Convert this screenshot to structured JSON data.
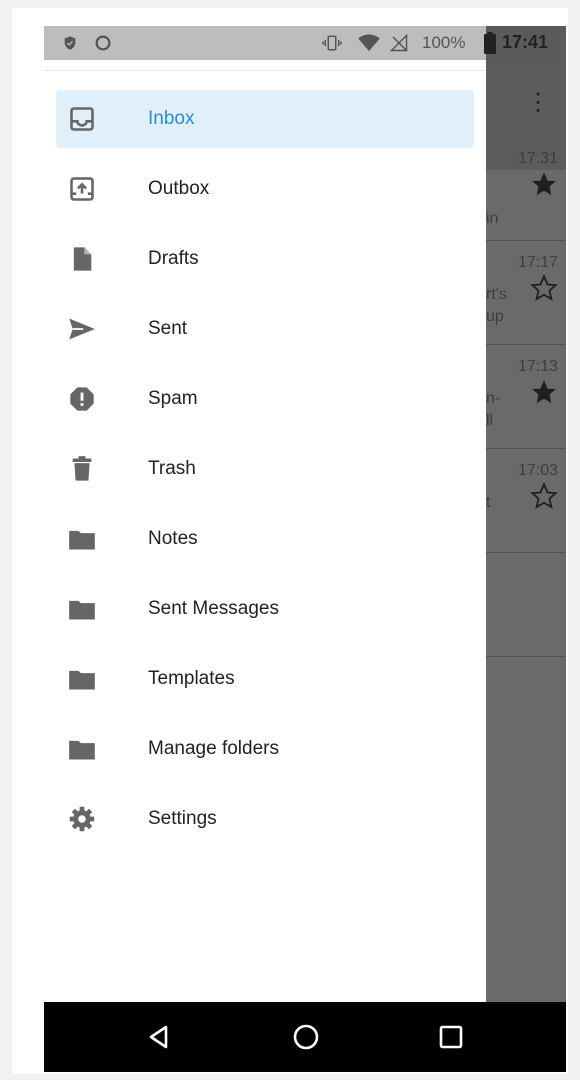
{
  "status_bar": {
    "battery": "100%",
    "time": "17:41",
    "icons": [
      "shield-icon",
      "circle-icon",
      "vibrate-icon",
      "wifi-icon",
      "no-signal-icon",
      "battery-icon"
    ]
  },
  "drawer": {
    "items": [
      {
        "label": "Inbox",
        "icon": "inbox-icon",
        "active": true
      },
      {
        "label": "Outbox",
        "icon": "outbox-icon"
      },
      {
        "label": "Drafts",
        "icon": "draft-file-icon"
      },
      {
        "label": "Sent",
        "icon": "send-icon"
      },
      {
        "label": "Spam",
        "icon": "spam-icon"
      },
      {
        "label": "Trash",
        "icon": "trash-icon"
      },
      {
        "label": "Notes",
        "icon": "folder-icon"
      },
      {
        "label": "Sent Messages",
        "icon": "folder-icon"
      },
      {
        "label": "Templates",
        "icon": "folder-icon"
      },
      {
        "label": "Manage folders",
        "icon": "folder-icon"
      },
      {
        "label": "Settings",
        "icon": "gear-icon"
      }
    ]
  },
  "background_list": {
    "menu_icon": "more-vert-icon",
    "rows": [
      {
        "time": "17:31",
        "snippet": "in",
        "starred": true
      },
      {
        "time": "17:17",
        "snippet": "rt's\nup",
        "starred": false
      },
      {
        "time": "17:13",
        "snippet": "n-\nll",
        "starred": true
      },
      {
        "time": "17:03",
        "snippet": "t",
        "starred": false
      }
    ]
  },
  "nav_bar": {
    "buttons": [
      "back-icon",
      "home-icon",
      "recents-icon"
    ]
  },
  "colors": {
    "accent": "#2a8fcf",
    "active_bg": "#e1effb",
    "icon_gray": "#757575"
  }
}
